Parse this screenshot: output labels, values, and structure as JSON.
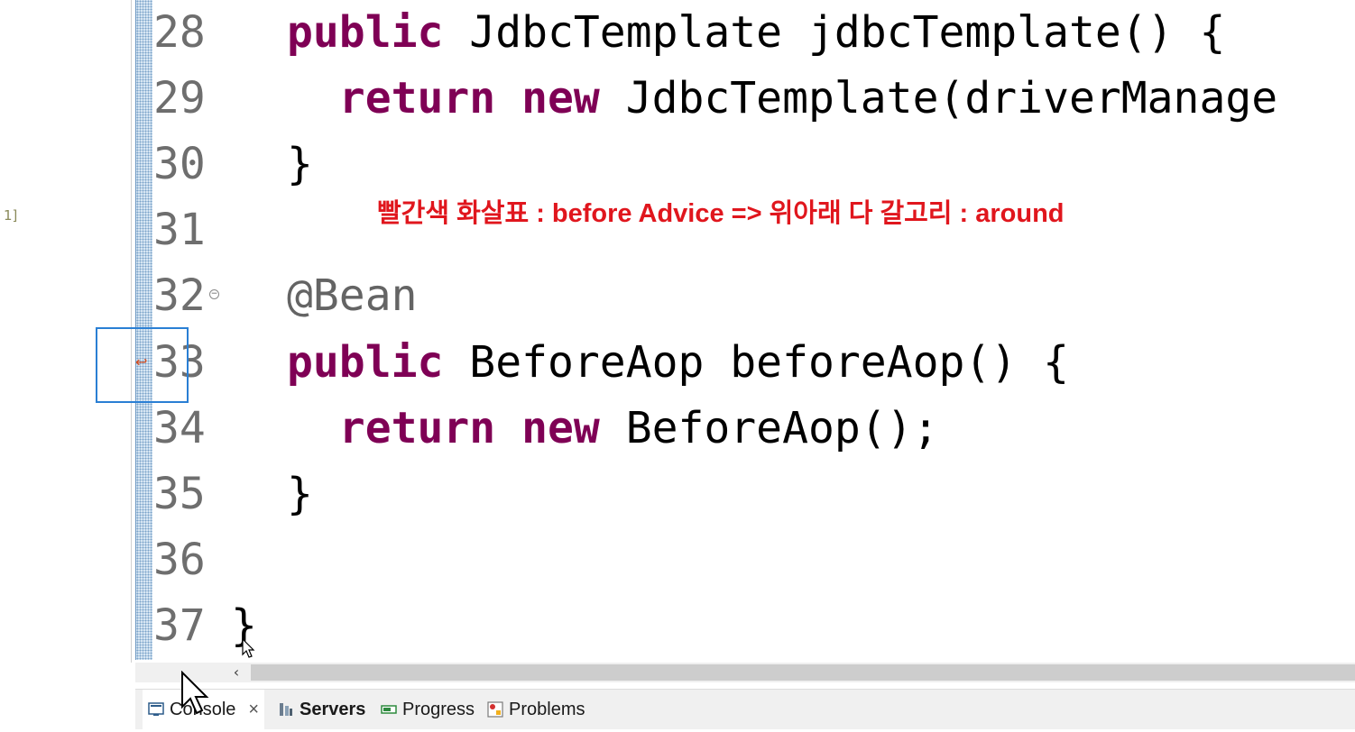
{
  "left_panel": {
    "fragment": "1]"
  },
  "editor": {
    "lines": [
      {
        "num": "28",
        "parts": [
          {
            "t": "public ",
            "c": "kw"
          },
          {
            "t": "JdbcTemplate jdbcTemplate() {",
            "c": ""
          }
        ]
      },
      {
        "num": "29",
        "parts": [
          {
            "t": "  return ",
            "c": "kw"
          },
          {
            "t": "new ",
            "c": "kw"
          },
          {
            "t": "JdbcTemplate(driverManage",
            "c": ""
          }
        ]
      },
      {
        "num": "30",
        "parts": [
          {
            "t": "}",
            "c": ""
          }
        ]
      },
      {
        "num": "31",
        "parts": []
      },
      {
        "num": "32",
        "parts": [
          {
            "t": "@Bean",
            "c": "ann"
          }
        ]
      },
      {
        "num": "33",
        "parts": [
          {
            "t": "public ",
            "c": "kw"
          },
          {
            "t": "BeforeAop beforeAop() {",
            "c": ""
          }
        ]
      },
      {
        "num": "34",
        "parts": [
          {
            "t": "  return ",
            "c": "kw"
          },
          {
            "t": "new ",
            "c": "kw"
          },
          {
            "t": "BeforeAop();",
            "c": ""
          }
        ]
      },
      {
        "num": "35",
        "parts": [
          {
            "t": "}",
            "c": ""
          }
        ]
      },
      {
        "num": "36",
        "parts": []
      },
      {
        "num": "37",
        "parts": [
          {
            "t": "}",
            "c": ""
          }
        ]
      }
    ]
  },
  "annotation_note": "빨간색 화살표 : before Advice => 위아래 다 갈고리 : around",
  "bottom_tabs": {
    "console": "Console",
    "servers": "Servers",
    "progress": "Progress",
    "problems": "Problems"
  },
  "colors": {
    "keyword": "#7f0055",
    "annotation": "#646464",
    "note": "#e0161d",
    "highlight": "#2a7fd4"
  },
  "icons": [
    "fold-collapse-icon",
    "override-arrow-icon",
    "scroll-left-icon",
    "console-icon",
    "servers-icon",
    "progress-icon",
    "problems-icon",
    "close-icon",
    "mouse-cursor-icon"
  ]
}
